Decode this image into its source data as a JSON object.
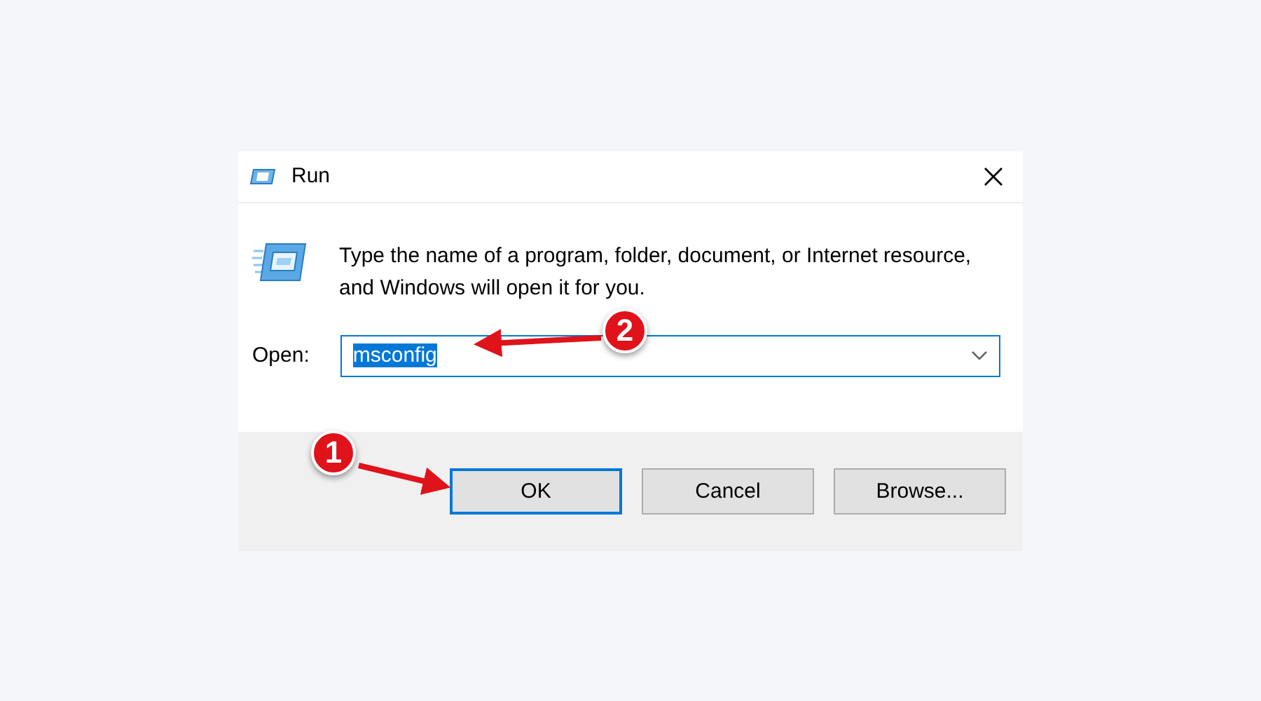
{
  "window": {
    "title": "Run"
  },
  "description": "Type the name of a program, folder, document, or Internet resource, and Windows will open it for you.",
  "open_field": {
    "label": "Open:",
    "value": "msconfig",
    "text_selected": true
  },
  "buttons": [
    {
      "label": "OK",
      "focused": true
    },
    {
      "label": "Cancel",
      "focused": false
    },
    {
      "label": "Browse...",
      "focused": false
    }
  ],
  "annotations": [
    {
      "label": "1"
    },
    {
      "label": "2"
    }
  ]
}
